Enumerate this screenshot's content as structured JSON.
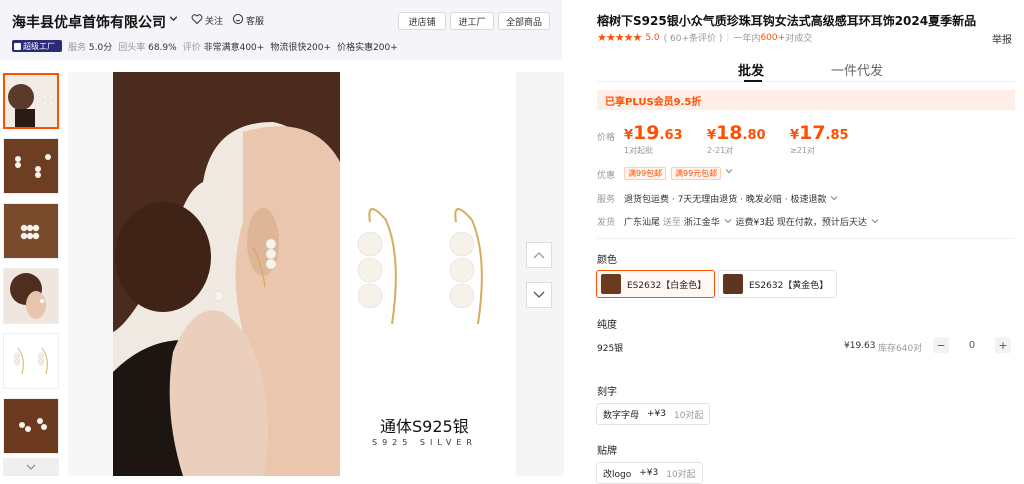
{
  "store": {
    "name": "海丰县优卓首饰有限公司",
    "follow_label": "关注",
    "service_label": "客服",
    "buttons": [
      "进店铺",
      "进工厂",
      "全部商品"
    ],
    "badge": "超级工厂",
    "stats": [
      {
        "label": "服务",
        "value": "5.0分"
      },
      {
        "label": "回头率",
        "value": "68.9%"
      },
      {
        "label": "评价",
        "value": "非常满意400+"
      },
      {
        "label": "",
        "value": "物流很快200+"
      },
      {
        "label": "",
        "value": "价格实惠200+"
      }
    ]
  },
  "gallery": {
    "image_title_zh": "通体S925银",
    "image_title_en": "S925 SILVER"
  },
  "product": {
    "title": "榕树下S925银小众气质珍珠耳钩女法式高级感耳环耳饰2024夏季新品",
    "stars": "★★★★★",
    "rating": "5.0",
    "review_count": "( 60+条评价 )",
    "sales_prefix": "一年内",
    "sales_count": "600+",
    "sales_suffix": "对成交",
    "report_label": "举报"
  },
  "tabs": [
    "批发",
    "一件代发"
  ],
  "plus_banner": "已享PLUS会员9.5折",
  "pricing": {
    "label": "价格",
    "tiers": [
      {
        "yen": "¥",
        "int": "19",
        "dec": ".63",
        "cond": "1对起批"
      },
      {
        "yen": "¥",
        "int": "18",
        "dec": ".80",
        "cond": "2-21对"
      },
      {
        "yen": "¥",
        "int": "17",
        "dec": ".85",
        "cond": "≥21对"
      }
    ]
  },
  "promo": {
    "label": "优惠",
    "coupons": [
      "满99包邮",
      "满99元包邮"
    ]
  },
  "service": {
    "label": "服务",
    "text": "退货包运费 · 7天无理由退货 · 晚发必赔 · 极速退款"
  },
  "shipping": {
    "label": "发货",
    "origin": "广东汕尾",
    "to_word": "送至",
    "dest": "浙江金华",
    "fee": "运费¥3起",
    "eta": "现在付款，预计后天达"
  },
  "color": {
    "label": "颜色",
    "options": [
      "ES2632【白金色】",
      "ES2632【黄金色】"
    ]
  },
  "purity": {
    "label": "纯度",
    "item": "925银",
    "price": "¥19.63",
    "stock": "库存640对",
    "qty": "0",
    "minus": "−",
    "plus": "+"
  },
  "engraving": {
    "label": "刻字",
    "name": "数字字母",
    "price": "+¥3",
    "min": "10对起"
  },
  "tag": {
    "label": "贴牌",
    "name": "改logo",
    "price": "+¥3",
    "min": "10对起"
  },
  "colors": {
    "accent": "#ff5000",
    "plus_bg": "#fdeee7"
  }
}
